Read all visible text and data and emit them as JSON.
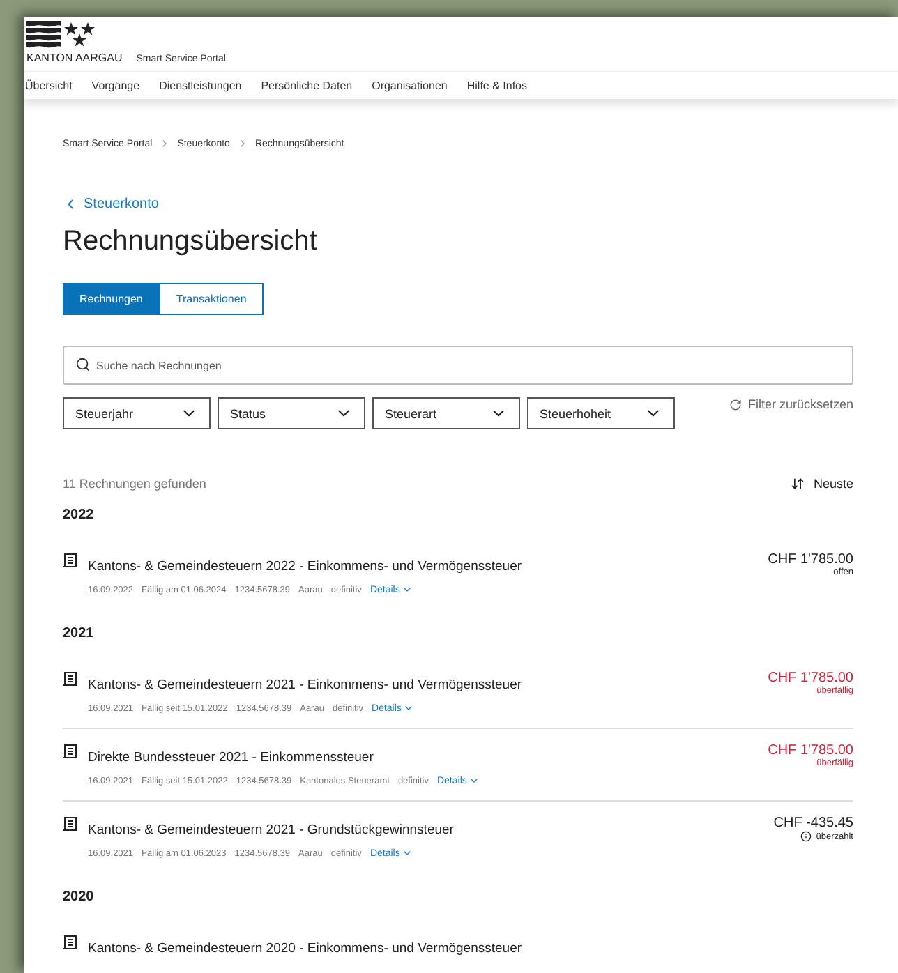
{
  "header": {
    "brand": "KANTON AARGAU",
    "portal": "Smart Service Portal"
  },
  "nav": [
    {
      "label": "Übersicht",
      "selected": false
    },
    {
      "label": "Vorgänge",
      "selected": false
    },
    {
      "label": "Dienstleistungen",
      "selected": false
    },
    {
      "label": "Persönliche Daten",
      "selected": false
    },
    {
      "label": "Organisationen",
      "selected": false
    },
    {
      "label": "Hilfe & Infos",
      "selected": false
    }
  ],
  "breadcrumb": [
    "Smart Service Portal",
    "Steuerkonto",
    "Rechnungsübersicht"
  ],
  "back_link": "Steuerkonto",
  "title": "Rechnungsübersicht",
  "tabs": [
    {
      "label": "Rechnungen",
      "selected": true
    },
    {
      "label": "Transaktionen",
      "selected": false
    }
  ],
  "search": {
    "placeholder": "Suche nach Rechnungen"
  },
  "filters": [
    "Steuerjahr",
    "Status",
    "Steuerart",
    "Steuerhoheit"
  ],
  "reset_filters": "Filter zurücksetzen",
  "result_count": "11 Rechnungen gefunden",
  "sort": "Neuste",
  "groups": [
    {
      "year": "2022",
      "invoices": [
        {
          "title": "Kantons- & Gemeindesteuern 2022 - Einkommens- und Vermögenssteuer",
          "meta": [
            "16.09.2022",
            "Fällig am 01.06.2024",
            "1234.5678.39",
            "Aarau",
            "definitiv"
          ],
          "details": "Details",
          "amount": "CHF 1'785.00",
          "status": "offen",
          "kind": "open"
        }
      ]
    },
    {
      "year": "2021",
      "invoices": [
        {
          "title": "Kantons- & Gemeindesteuern 2021 - Einkommens- und Vermögenssteuer",
          "meta": [
            "16.09.2021",
            "Fällig seit 15.01.2022",
            "1234.5678.39",
            "Aarau",
            "definitiv"
          ],
          "details": "Details",
          "amount": "CHF 1'785.00",
          "status": "überfällig",
          "kind": "overdue"
        },
        {
          "title": "Direkte Bundessteuer 2021 - Einkommenssteuer",
          "meta": [
            "16.09.2021",
            "Fällig seit 15.01.2022",
            "1234.5678.39",
            "Kantonales Steueramt",
            "definitiv"
          ],
          "details": "Details",
          "amount": "CHF 1'785.00",
          "status": "überfällig",
          "kind": "overdue"
        },
        {
          "title": "Kantons- & Gemeindesteuern 2021 - Grundstückgewinnsteuer",
          "meta": [
            "16.09.2021",
            "Fällig am 01.06.2023",
            "1234.5678.39",
            "Aarau",
            "definitiv"
          ],
          "details": "Details",
          "amount": "CHF -435.45",
          "status": "überzahlt",
          "kind": "overpaid"
        }
      ]
    },
    {
      "year": "2020",
      "invoices": [
        {
          "title": "Kantons- & Gemeindesteuern 2020 - Einkommens- und Vermögenssteuer",
          "kind": "partial"
        }
      ]
    }
  ]
}
